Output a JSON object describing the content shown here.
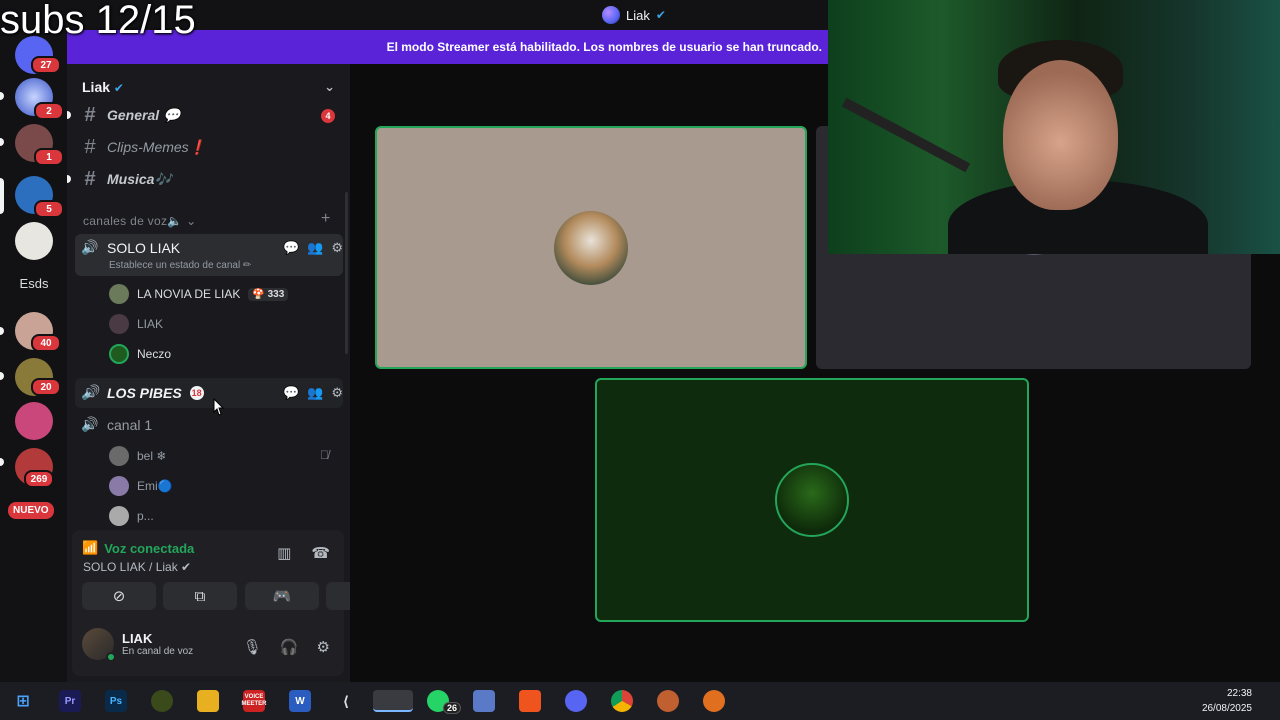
{
  "overlay": {
    "subs_text": "subs 12/15"
  },
  "window": {
    "title": "Liak",
    "title_badge": "✔"
  },
  "banner": {
    "text": "El modo Streamer está habilitado. Los nombres de usuario se han truncado."
  },
  "rail": {
    "badges": [
      "27",
      "2",
      "1",
      "5",
      "40",
      "20",
      "269"
    ],
    "esds_label": "Esds",
    "nuevo_label": "NUEVO"
  },
  "guild": {
    "name": "Liak",
    "verified": "✔"
  },
  "channels": [
    {
      "name": "General 💬",
      "badge": "4"
    },
    {
      "name": "Clips-Memes❗"
    },
    {
      "name": "Musica🎶"
    }
  ],
  "category": {
    "label": "canales de voz🔈 ⌄"
  },
  "voice_channels": {
    "solo_liak": {
      "name": "SOLO LIAK",
      "status": "Establece un estado de canal ✏"
    },
    "los_pibes": {
      "name": "LOS PIBES",
      "badge": "18"
    },
    "canal1": {
      "name": "canal 1"
    }
  },
  "members_solo": [
    {
      "name": "LA NOVIA DE LIAK",
      "tag": "🍄 333"
    },
    {
      "name": "LIAK"
    },
    {
      "name": "Neczo"
    }
  ],
  "members_canal1": [
    {
      "name": "bel ❄"
    },
    {
      "name": "Emi🔵"
    },
    {
      "name": "p..."
    }
  ],
  "voice_panel": {
    "status": "Voz conectada",
    "location": "SOLO LIAK / Liak ✔"
  },
  "user": {
    "name": "LIAK",
    "status": "En canal de voz"
  },
  "taskbar": {
    "pr": "Pr",
    "ps": "Ps",
    "voicemeeter": "VOICE MEETER",
    "word": "W",
    "whatsapp_badge": "26",
    "time": "22:38",
    "date": "26/08/2025"
  },
  "colors": {
    "accent": "#5a23d8",
    "online": "#23a55a",
    "danger": "#da373c"
  }
}
